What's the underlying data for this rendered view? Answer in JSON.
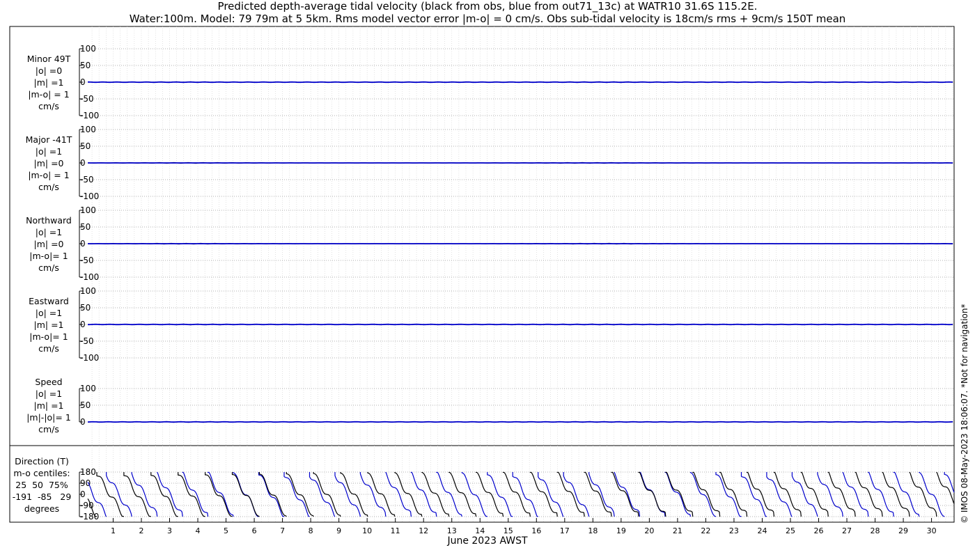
{
  "header": {
    "title_line1": "Predicted depth-average tidal velocity (black from obs, blue from out71_13c) at WATR10 31.6S 115.2E.",
    "title_line2": "Water:100m. Model: 79 79m at 5 5km. Rms model vector error |m-o| = 0 cm/s. Obs sub-tidal velocity is 18cm/s rms + 9cm/s 150T mean"
  },
  "credit": "© IMOS 08-May-2023 18:06:07.  *Not for navigation*",
  "colors": {
    "obs": "#000000",
    "model": "#0000cc",
    "grid": "#999999"
  },
  "chart_data": {
    "type": "line",
    "xlabel": "June 2023 AWST",
    "x_ticks": [
      "1",
      "2",
      "3",
      "4",
      "5",
      "6",
      "7",
      "8",
      "9",
      "10",
      "11",
      "12",
      "13",
      "14",
      "15",
      "16",
      "17",
      "18",
      "19",
      "20",
      "21",
      "22",
      "23",
      "24",
      "25",
      "26",
      "27",
      "28",
      "29",
      "30"
    ],
    "xlim": [
      0.1,
      30.8
    ],
    "panels": [
      {
        "name": "minor",
        "label_lines": [
          "Minor 49T",
          "|o| =0",
          "|m| =1",
          "|m-o| = 1",
          "cm/s"
        ],
        "ylim": [
          -100,
          100
        ],
        "yticks": [
          -100,
          -50,
          0,
          50,
          100
        ],
        "obs_amp": 1,
        "model_amp": 1
      },
      {
        "name": "major",
        "label_lines": [
          "Major -41T",
          "|o| =1",
          "|m| =0",
          "|m-o| = 1",
          "cm/s"
        ],
        "ylim": [
          -100,
          100
        ],
        "yticks": [
          -100,
          -50,
          0,
          50,
          100
        ],
        "obs_amp": 1,
        "model_amp": 0
      },
      {
        "name": "northward",
        "label_lines": [
          "Northward",
          "|o| =1",
          "|m| =0",
          "|m-o|= 1",
          "cm/s"
        ],
        "ylim": [
          -100,
          100
        ],
        "yticks": [
          -100,
          -50,
          0,
          50,
          100
        ],
        "obs_amp": 1,
        "model_amp": 0
      },
      {
        "name": "eastward",
        "label_lines": [
          "Eastward",
          "|o| =1",
          "|m| =1",
          "|m-o|= 1",
          "cm/s"
        ],
        "ylim": [
          -100,
          100
        ],
        "yticks": [
          -100,
          -50,
          0,
          50,
          100
        ],
        "obs_amp": 1,
        "model_amp": 1
      },
      {
        "name": "speed",
        "label_lines": [
          "Speed",
          "|o| =1",
          "|m| =1",
          "|m|-|o|= 1",
          "cm/s"
        ],
        "ylim": [
          0,
          100
        ],
        "yticks": [
          0,
          50,
          100
        ],
        "obs_amp": 1,
        "model_amp": 1
      }
    ],
    "direction_panel": {
      "label_lines": [
        "Direction (T)",
        "m-o centiles:",
        "25  50  75%",
        "-191  -85   29",
        "degrees"
      ],
      "ylim": [
        -180,
        180
      ],
      "yticks": [
        -180,
        -90,
        0,
        90,
        180
      ],
      "obs_period_days": 0.96,
      "model_period_days": 0.9
    }
  }
}
